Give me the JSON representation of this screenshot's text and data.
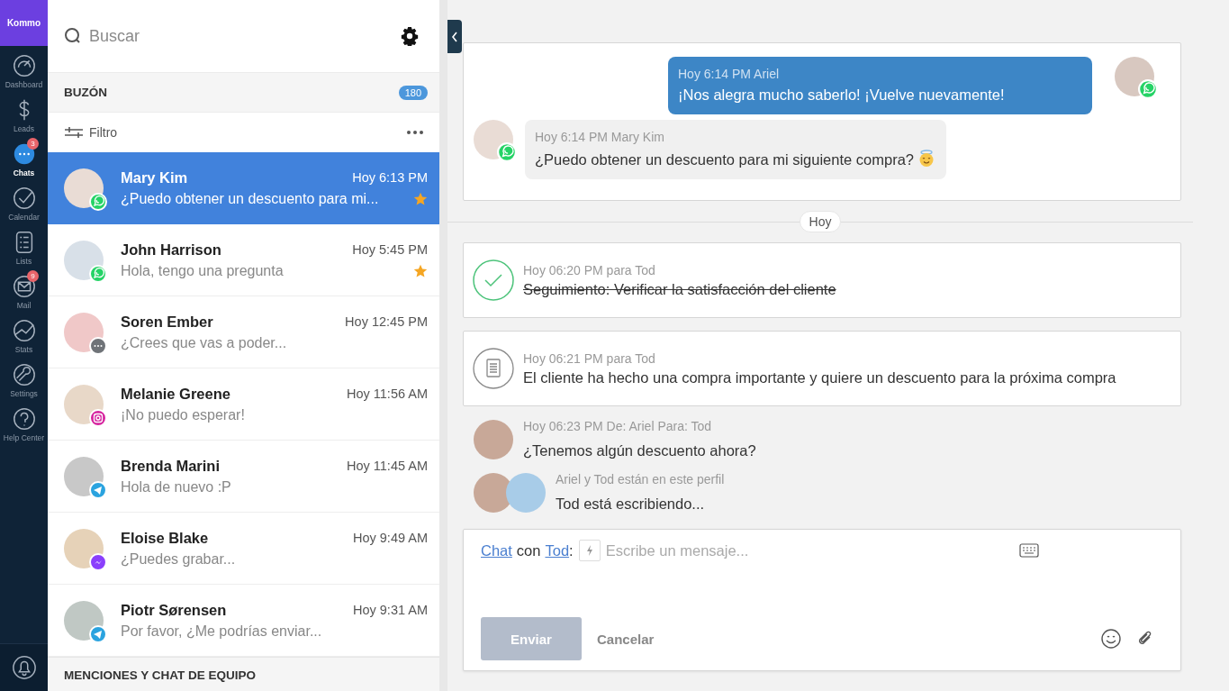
{
  "nav": {
    "logo": "Kommo",
    "items": [
      {
        "label": "Dashboard",
        "selected": false
      },
      {
        "label": "Leads",
        "selected": false
      },
      {
        "label": "Chats",
        "selected": true,
        "badge": "3"
      },
      {
        "label": "Calendar",
        "selected": false
      },
      {
        "label": "Lists",
        "selected": false
      },
      {
        "label": "Mail",
        "selected": false,
        "badge": "9"
      },
      {
        "label": "Stats",
        "selected": false
      },
      {
        "label": "Settings",
        "selected": false
      },
      {
        "label": "Help Center",
        "selected": false
      }
    ]
  },
  "inbox": {
    "search": {
      "placeholder": "Buscar"
    },
    "title": "BUZÓN",
    "count": "180",
    "filter": "Filtro",
    "conversations": [
      {
        "name": "Mary Kim",
        "time": "Hoy 6:13 PM",
        "preview": "¿Puedo obtener un descuento para mi...",
        "badge": {
          "kind": "whatsapp"
        },
        "starred": true,
        "selected": true
      },
      {
        "name": "John Harrison",
        "time": "Hoy 5:45 PM",
        "preview": "Hola, tengo una pregunta",
        "badge": {
          "kind": "whatsapp"
        },
        "starred": true,
        "selected": false
      },
      {
        "name": "Soren Ember",
        "time": "Hoy 12:45 PM",
        "preview": "¿Crees que vas a poder...",
        "badge": {
          "kind": "chat"
        },
        "starred": false,
        "selected": false
      },
      {
        "name": "Melanie Greene",
        "time": "Hoy 11:56 AM",
        "preview": "¡No puedo esperar!",
        "badge": {
          "kind": "instagram"
        },
        "starred": false,
        "selected": false
      },
      {
        "name": "Brenda Marini",
        "time": "Hoy 11:45 AM",
        "preview": "Hola de nuevo :P",
        "badge": {
          "kind": "telegram"
        },
        "starred": false,
        "selected": false
      },
      {
        "name": "Eloise Blake",
        "time": "Hoy 9:49 AM",
        "preview": "¿Puedes grabar...",
        "badge": {
          "kind": "messenger"
        },
        "starred": false,
        "selected": false
      },
      {
        "name": "Piotr Sørensen",
        "time": "Hoy 9:31 AM",
        "preview": "Por favor, ¿Me podrías enviar...",
        "badge": {
          "kind": "telegram"
        },
        "starred": false,
        "selected": false
      }
    ],
    "footer": "MENCIONES Y CHAT DE EQUIPO"
  },
  "feed": {
    "messages": [
      {
        "kind": "outgoing",
        "meta": "Hoy 6:14 PM Ariel",
        "text": "¡Nos alegra mucho saberlo! ¡Vuelve nuevamente!",
        "badge": {
          "kind": "whatsapp"
        }
      },
      {
        "kind": "incoming",
        "meta": "Hoy 6:14 PM Mary Kim",
        "text": "¿Puedo obtener un descuento para mi siguiente compra?",
        "badge": {
          "kind": "whatsapp"
        }
      }
    ],
    "date": "Hoy",
    "events": [
      {
        "kind": "task",
        "meta": "Hoy 06:20 PM para Tod",
        "text": "Seguimiento: Verificar la satisfacción del cliente",
        "completed": true
      },
      {
        "kind": "note",
        "meta": "Hoy 06:21 PM para Tod",
        "text": "El cliente ha hecho una compra importante y quiere un descuento para la próxima compra"
      }
    ],
    "internal": {
      "meta": "Hoy 06:23 PM De: Ariel Para: Tod",
      "text": "¿Tenemos algún descuento ahora?"
    },
    "typing": {
      "meta": "Ariel y Tod están en este perfil",
      "text": "Tod está escribiendo..."
    }
  },
  "composer": {
    "mode": "Chat",
    "with": "con",
    "recipient": "Tod",
    "colon": ":",
    "placeholder": "Escribe un mensaje...",
    "send": {
      "label": "Enviar",
      "disabled": true
    },
    "cancel": "Cancelar"
  }
}
